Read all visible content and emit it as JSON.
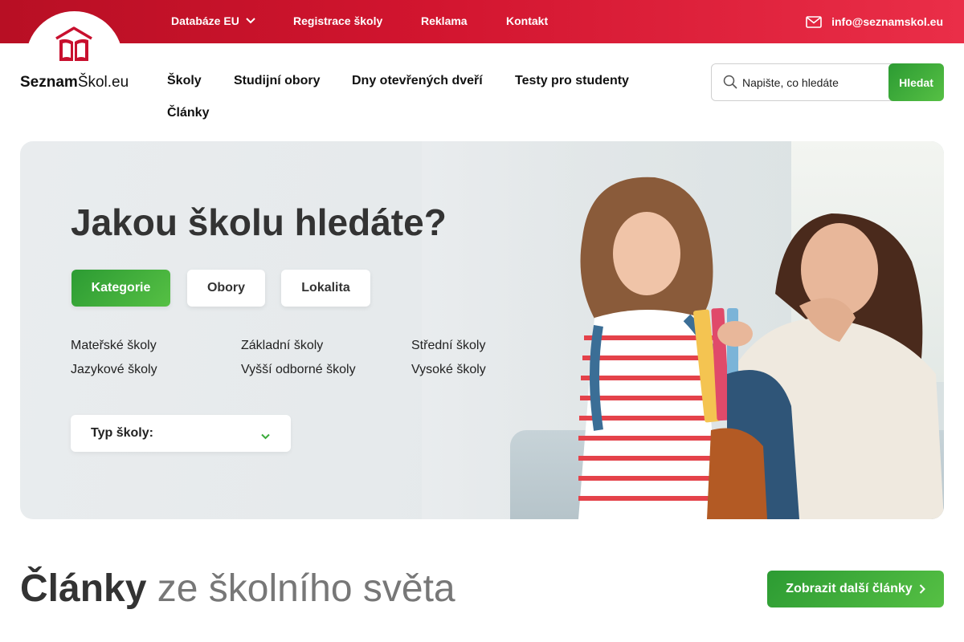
{
  "topbar": {
    "items": [
      {
        "label": "Databáze EU",
        "has_dropdown": true
      },
      {
        "label": "Registrace školy"
      },
      {
        "label": "Reklama"
      },
      {
        "label": "Kontakt"
      }
    ],
    "email": "info@seznamskol.eu"
  },
  "logo": {
    "bold": "Seznam",
    "rest": "Škol.eu"
  },
  "mainnav": {
    "links": [
      "Školy",
      "Studijní obory",
      "Dny otevřených dveří",
      "Testy pro studenty",
      "Články"
    ]
  },
  "search": {
    "placeholder": "Napište, co hledáte",
    "button": "Hledat"
  },
  "hero": {
    "title": "Jakou školu hledáte?",
    "tabs": [
      {
        "label": "Kategorie",
        "active": true
      },
      {
        "label": "Obory",
        "active": false
      },
      {
        "label": "Lokalita",
        "active": false
      }
    ],
    "categories": [
      "Mateřské školy",
      "Základní školy",
      "Střední školy",
      "Jazykové školy",
      "Vyšší odborné školy",
      "Vysoké školy"
    ],
    "select_label": "Typ školy:"
  },
  "articles": {
    "title_bold": "Články",
    "title_light": "ze školního světa",
    "more_button": "Zobrazit další články"
  },
  "colors": {
    "brand_red": "#d2152f",
    "accent_green": "#3aab3a",
    "text_dark": "#333333"
  },
  "icons": [
    "book-house-logo-icon",
    "chevron-down-icon",
    "mail-icon",
    "search-icon",
    "chevron-right-icon"
  ]
}
